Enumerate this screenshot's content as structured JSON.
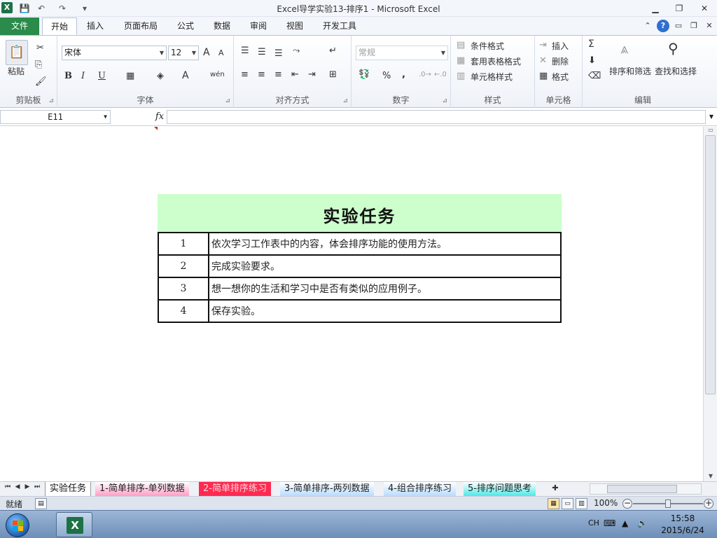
{
  "window": {
    "title": "Excel导学实验13-排序1  -  Microsoft Excel",
    "app_icon_letter": "X"
  },
  "quick_access": {
    "save_glyph": "💾",
    "undo_glyph": "↶",
    "redo_glyph": "↷",
    "customize_glyph": "▾"
  },
  "ribbon_tabs": {
    "file": "文件",
    "items": [
      "开始",
      "插入",
      "页面布局",
      "公式",
      "数据",
      "审阅",
      "视图",
      "开发工具"
    ],
    "active": "开始"
  },
  "ribbon": {
    "clipboard": {
      "label": "剪贴板",
      "paste": "粘贴"
    },
    "font": {
      "label": "字体",
      "font_name": "宋体",
      "font_size": "12",
      "grow": "A",
      "shrink": "A",
      "bold": "B",
      "italic": "I",
      "underline": "U",
      "wen": "wén"
    },
    "alignment": {
      "label": "对齐方式"
    },
    "number": {
      "label": "数字",
      "format": "常规",
      "percent": "%",
      "comma": ","
    },
    "styles": {
      "label": "样式",
      "conditional": "条件格式",
      "table": "套用表格格式",
      "cell": "单元格样式"
    },
    "cells": {
      "label": "单元格",
      "insert": "插入",
      "delete": "删除",
      "format": "格式"
    },
    "editing": {
      "label": "编辑",
      "sigma": "Σ",
      "sort": "排序和筛选",
      "find": "查找和选择"
    }
  },
  "formula_bar": {
    "name_box": "E11",
    "fx": "fx",
    "value": ""
  },
  "task": {
    "title": "实验任务",
    "rows": [
      {
        "num": "1",
        "text": "依次学习工作表中的内容，体会排序功能的使用方法。"
      },
      {
        "num": "2",
        "text": "完成实验要求。"
      },
      {
        "num": "3",
        "text": "想一想你的生活和学习中是否有类似的应用例子。"
      },
      {
        "num": "4",
        "text": "保存实验。"
      }
    ]
  },
  "sheet_tabs": [
    {
      "label": "实验任务",
      "active": true,
      "color": "#ffffff"
    },
    {
      "label": "1-简单排序-单列数据",
      "active": false,
      "color": "#ff9fc6"
    },
    {
      "label": "2-简单排序练习",
      "active": false,
      "color": "#ff2a50"
    },
    {
      "label": "3-简单排序-两列数据",
      "active": false,
      "color": "#b8dcff"
    },
    {
      "label": "4-组合排序练习",
      "active": false,
      "color": "#b8dcff"
    },
    {
      "label": "5-排序问题思考",
      "active": false,
      "color": "#4fe8e8"
    }
  ],
  "status": {
    "ready": "就绪",
    "zoom": "100%"
  },
  "taskbar": {
    "lang": "CH",
    "time": "15:58",
    "date": "2015/6/24"
  }
}
